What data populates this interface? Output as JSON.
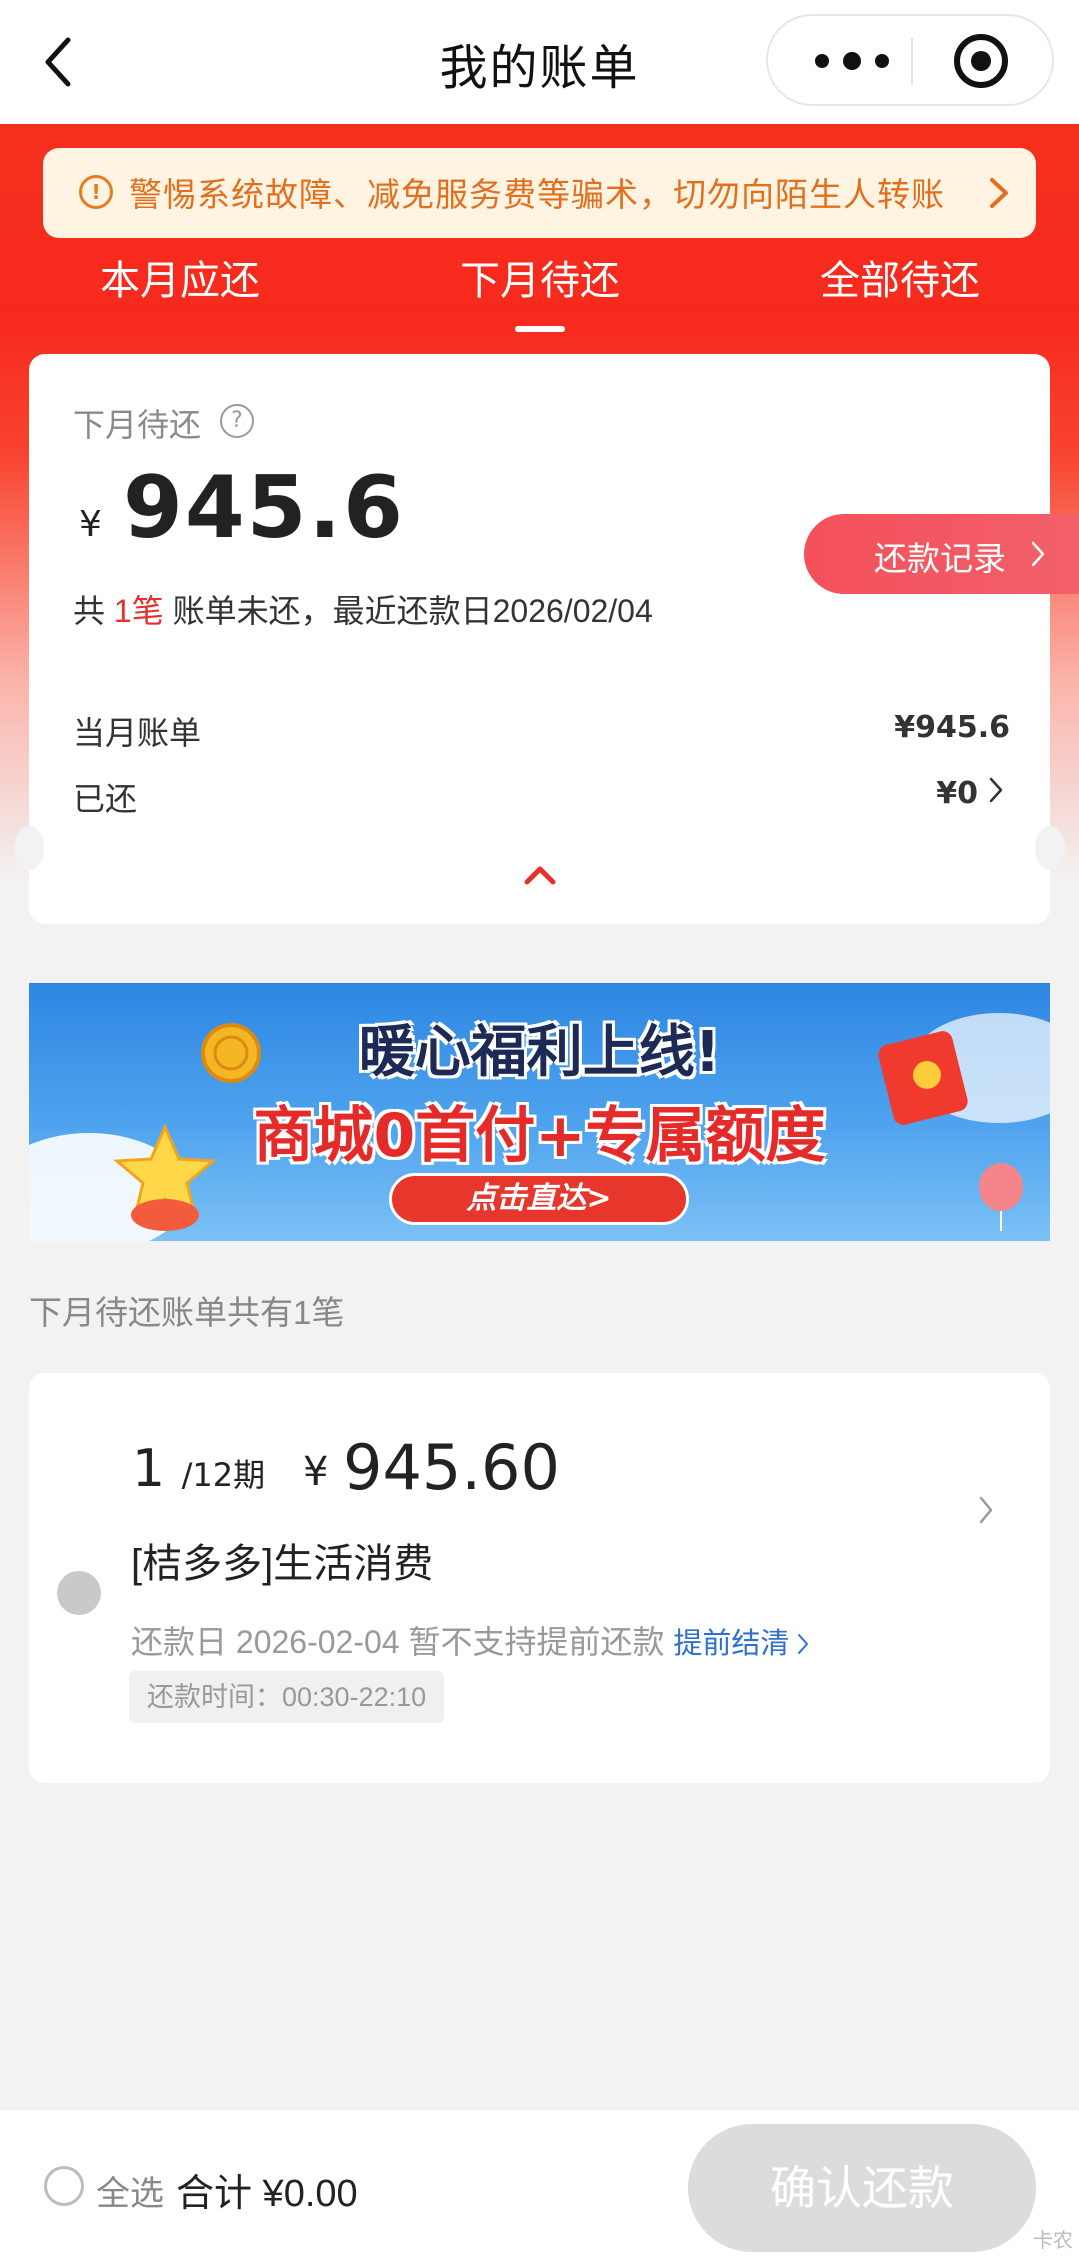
{
  "nav": {
    "title": "我的账单"
  },
  "warning": {
    "icon": "!",
    "text": "警惕系统故障、减免服务费等骗术，切勿向陌生人转账"
  },
  "tabs": [
    {
      "label": "本月应还"
    },
    {
      "label": "下月待还",
      "active": true
    },
    {
      "label": "全部待还"
    }
  ],
  "summary": {
    "label": "下月待还",
    "help_icon": "?",
    "currency": "¥",
    "amount": "945.6",
    "count_prefix": "共 ",
    "count": "1笔",
    "count_suffix": " 账单未还，最近还款日2026/02/04",
    "current_bill_label": "当月账单",
    "current_bill_value": "¥945.6",
    "paid_label": "已还",
    "paid_value": "¥0",
    "record_button": "还款记录"
  },
  "promo": {
    "headline": "暖心福利上线!",
    "subline": "商城0首付+专属额度",
    "cta": "点击直达>"
  },
  "section_title": "下月待还账单共有1笔",
  "bill": {
    "period_current": "1",
    "period_total": "/12期",
    "currency": "¥",
    "amount": "945.60",
    "name": "[桔多多]生活消费",
    "due_text": "还款日 2026-02-04 暂不支持提前还款",
    "early_settle_link": "提前结清",
    "time_label": "还款时间：00:30-22:10"
  },
  "footer": {
    "select_all": "全选",
    "total_label": "合计 ¥0.00",
    "confirm_button": "确认还款"
  },
  "watermark": "卡农",
  "colors": {
    "brand_red": "#f5301e",
    "warning_orange": "#e36f1e",
    "link_blue": "#2f6fcf"
  }
}
